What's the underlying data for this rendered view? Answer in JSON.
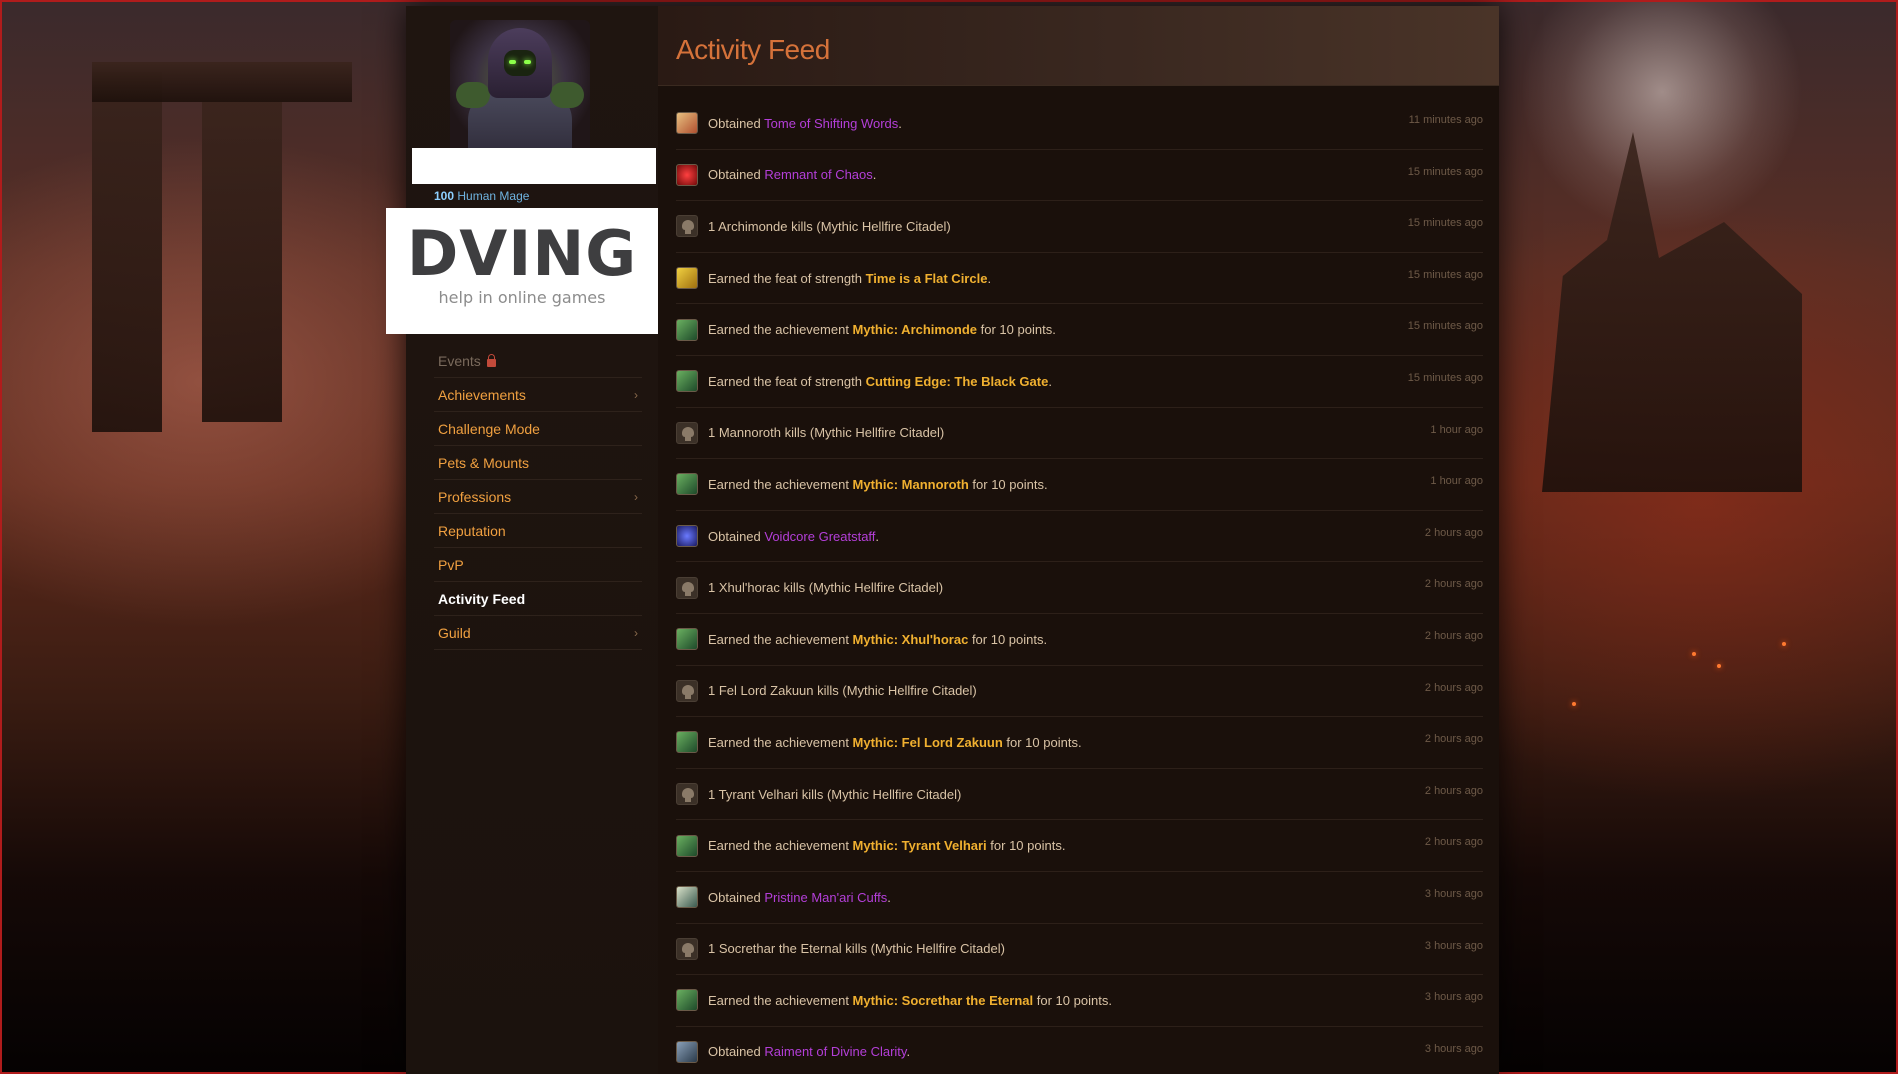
{
  "character": {
    "level": "100",
    "race_class": "Human Mage"
  },
  "logo": {
    "brand": "DVING",
    "tagline": "help in online games"
  },
  "nav": {
    "items": [
      {
        "label": "Events",
        "state": "locked",
        "has_submenu": false
      },
      {
        "label": "Achievements",
        "state": "normal",
        "has_submenu": true
      },
      {
        "label": "Challenge Mode",
        "state": "normal",
        "has_submenu": false
      },
      {
        "label": "Pets & Mounts",
        "state": "normal",
        "has_submenu": false
      },
      {
        "label": "Professions",
        "state": "normal",
        "has_submenu": true
      },
      {
        "label": "Reputation",
        "state": "normal",
        "has_submenu": false
      },
      {
        "label": "PvP",
        "state": "normal",
        "has_submenu": false
      },
      {
        "label": "Activity Feed",
        "state": "active",
        "has_submenu": false
      },
      {
        "label": "Guild",
        "state": "normal",
        "has_submenu": true
      }
    ]
  },
  "page_title": "Activity Feed",
  "feed": [
    {
      "icon": "tome",
      "prefix": "Obtained ",
      "link": "Tome of Shifting Words",
      "link_style": "epic",
      "suffix": ".",
      "time": "11 minutes ago"
    },
    {
      "icon": "chaos",
      "prefix": "Obtained ",
      "link": "Remnant of Chaos",
      "link_style": "epic",
      "suffix": ".",
      "time": "15 minutes ago"
    },
    {
      "icon": "skull",
      "prefix": "1 Archimonde kills (Mythic Hellfire Citadel)",
      "link": "",
      "link_style": "",
      "suffix": "",
      "time": "15 minutes ago"
    },
    {
      "icon": "feat",
      "prefix": "Earned the feat of strength ",
      "link": "Time is a Flat Circle",
      "link_style": "gold",
      "suffix": ".",
      "time": "15 minutes ago"
    },
    {
      "icon": "ach",
      "prefix": "Earned the achievement ",
      "link": "Mythic: Archimonde",
      "link_style": "gold",
      "suffix": " for 10 points.",
      "time": "15 minutes ago"
    },
    {
      "icon": "ach",
      "prefix": "Earned the feat of strength ",
      "link": "Cutting Edge: The Black Gate",
      "link_style": "gold",
      "suffix": ".",
      "time": "15 minutes ago"
    },
    {
      "icon": "skull",
      "prefix": "1 Mannoroth kills (Mythic Hellfire Citadel)",
      "link": "",
      "link_style": "",
      "suffix": "",
      "time": "1 hour ago"
    },
    {
      "icon": "ach",
      "prefix": "Earned the achievement ",
      "link": "Mythic: Mannoroth",
      "link_style": "gold",
      "suffix": " for 10 points.",
      "time": "1 hour ago"
    },
    {
      "icon": "staff",
      "prefix": "Obtained ",
      "link": "Voidcore Greatstaff",
      "link_style": "epic",
      "suffix": ".",
      "time": "2 hours ago"
    },
    {
      "icon": "skull",
      "prefix": "1 Xhul'horac kills (Mythic Hellfire Citadel)",
      "link": "",
      "link_style": "",
      "suffix": "",
      "time": "2 hours ago"
    },
    {
      "icon": "ach",
      "prefix": "Earned the achievement ",
      "link": "Mythic: Xhul'horac",
      "link_style": "gold",
      "suffix": " for 10 points.",
      "time": "2 hours ago"
    },
    {
      "icon": "skull",
      "prefix": "1 Fel Lord Zakuun kills (Mythic Hellfire Citadel)",
      "link": "",
      "link_style": "",
      "suffix": "",
      "time": "2 hours ago"
    },
    {
      "icon": "ach",
      "prefix": "Earned the achievement ",
      "link": "Mythic: Fel Lord Zakuun",
      "link_style": "gold",
      "suffix": " for 10 points.",
      "time": "2 hours ago"
    },
    {
      "icon": "skull",
      "prefix": "1 Tyrant Velhari kills (Mythic Hellfire Citadel)",
      "link": "",
      "link_style": "",
      "suffix": "",
      "time": "2 hours ago"
    },
    {
      "icon": "ach",
      "prefix": "Earned the achievement ",
      "link": "Mythic: Tyrant Velhari",
      "link_style": "gold",
      "suffix": " for 10 points.",
      "time": "2 hours ago"
    },
    {
      "icon": "cuffs",
      "prefix": "Obtained ",
      "link": "Pristine Man'ari Cuffs",
      "link_style": "epic",
      "suffix": ".",
      "time": "3 hours ago"
    },
    {
      "icon": "skull",
      "prefix": "1 Socrethar the Eternal kills (Mythic Hellfire Citadel)",
      "link": "",
      "link_style": "",
      "suffix": "",
      "time": "3 hours ago"
    },
    {
      "icon": "ach",
      "prefix": "Earned the achievement ",
      "link": "Mythic: Socrethar the Eternal",
      "link_style": "gold",
      "suffix": " for 10 points.",
      "time": "3 hours ago"
    },
    {
      "icon": "raiment",
      "prefix": "Obtained ",
      "link": "Raiment of Divine Clarity",
      "link_style": "epic",
      "suffix": ".",
      "time": "3 hours ago"
    }
  ],
  "colors": {
    "accent_orange": "#f0a040",
    "title": "#d5723a",
    "epic_purple": "#b43fd9",
    "gold_link": "#f0b030"
  }
}
